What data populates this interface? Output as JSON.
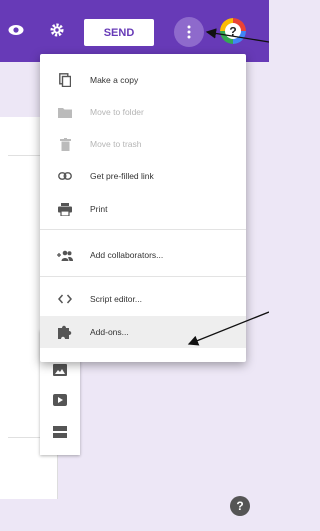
{
  "topbar": {
    "color": "#673ab7",
    "send_label": "SEND",
    "eye_icon": "eye-icon",
    "settings_icon": "gear-icon",
    "more_icon": "more-vert-icon",
    "help_glyph": "?"
  },
  "menu": {
    "items": [
      {
        "label": "Make a copy",
        "icon": "copy-icon",
        "enabled": true
      },
      {
        "label": "Move to folder",
        "icon": "folder-icon",
        "enabled": false
      },
      {
        "label": "Move to trash",
        "icon": "trash-icon",
        "enabled": false
      },
      {
        "label": "Get pre-filled link",
        "icon": "link-icon",
        "enabled": true
      },
      {
        "label": "Print",
        "icon": "print-icon",
        "enabled": true
      },
      {
        "label": "Add collaborators...",
        "icon": "add-people-icon",
        "enabled": true
      },
      {
        "label": "Script editor...",
        "icon": "code-icon",
        "enabled": true
      },
      {
        "label": "Add-ons...",
        "icon": "puzzle-icon",
        "enabled": true,
        "highlighted": true
      }
    ]
  },
  "side_toolbar": {
    "icons": [
      "image-icon",
      "video-icon",
      "section-icon"
    ]
  },
  "footer": {
    "help_glyph": "?"
  }
}
